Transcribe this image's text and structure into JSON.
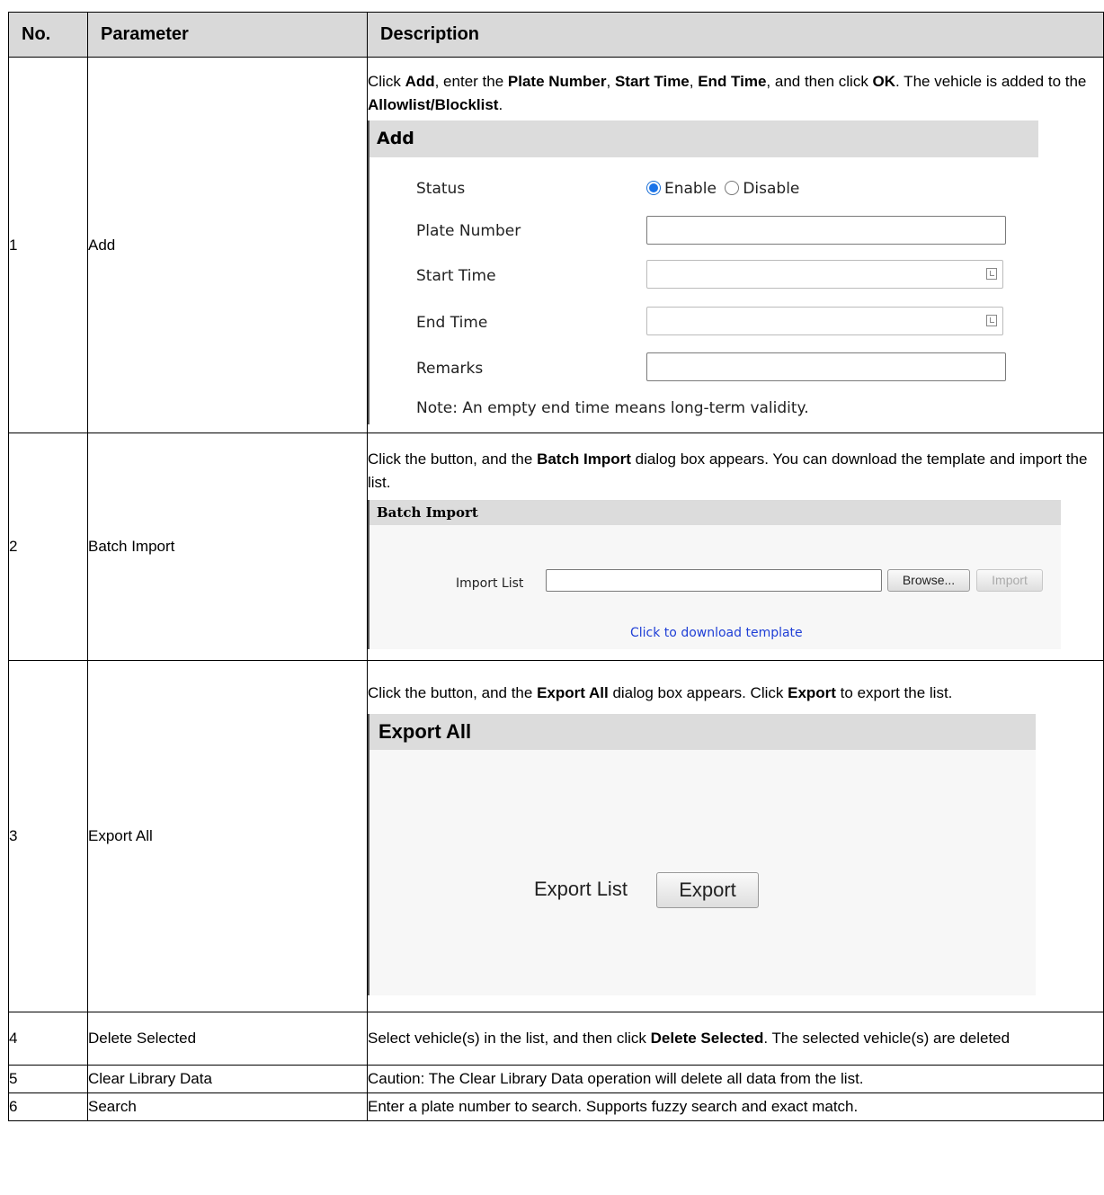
{
  "headers": {
    "no": "No.",
    "parameter": "Parameter",
    "description": "Description"
  },
  "rows": [
    {
      "no": "1",
      "parameter": "Add",
      "desc": {
        "t1": "Click ",
        "b1": "Add",
        "t2": ", enter the ",
        "b2": "Plate Number",
        "t3": ", ",
        "b3": "Start Time",
        "t4": ", ",
        "b4": "End Time",
        "t5": ", and then click ",
        "b5": "OK",
        "t6": ". The vehicle is added to the ",
        "b6": "Allowlist/Blocklist",
        "t7": "."
      }
    },
    {
      "no": "2",
      "parameter": "Batch Import",
      "desc": {
        "t1": "Click the button, and the ",
        "b1": "Batch Import",
        "t2": " dialog box appears. You can download the template and import the list."
      }
    },
    {
      "no": "3",
      "parameter": "Export All",
      "desc": {
        "t1": "Click the button, and the ",
        "b1": "Export All",
        "t2": " dialog box appears. Click ",
        "b2": "Export",
        "t3": " to export the list."
      }
    },
    {
      "no": "4",
      "parameter": "Delete Selected",
      "desc": {
        "t1": "Select vehicle(s) in the list, and then click ",
        "b1": "Delete Selected",
        "t2": ". The selected vehicle(s) are deleted"
      }
    },
    {
      "no": "5",
      "parameter": "Clear Library Data",
      "desc": {
        "t1": "Caution: The Clear Library Data operation will delete all data from the list."
      }
    },
    {
      "no": "6",
      "parameter": "Search",
      "desc": {
        "t1": "Enter a plate number to search. Supports fuzzy search and exact match."
      }
    }
  ],
  "add_dialog": {
    "title": "Add",
    "status_label": "Status",
    "enable_label": "Enable",
    "disable_label": "Disable",
    "status_value": "Enable",
    "plate_label": "Plate Number",
    "plate_value": "",
    "start_label": "Start Time",
    "start_value": "",
    "end_label": "End Time",
    "end_value": "",
    "remarks_label": "Remarks",
    "remarks_value": "",
    "note_prefix": "Note:",
    "note_text": " An empty end time means long-term validity."
  },
  "import_dialog": {
    "title": "Batch Import",
    "list_label": "Import List",
    "file_value": "",
    "browse_label": "Browse...",
    "import_label": "Import",
    "template_link": "Click to download template"
  },
  "export_dialog": {
    "title": "Export All",
    "list_label": "Export List",
    "export_label": "Export"
  },
  "colors": {
    "header_bg": "#d9d9d9",
    "dialog_title_bg": "#dcdcdc",
    "dialog_body_bg": "#f7f7f7",
    "link": "#1f3fd6",
    "radio_on": "#1a73e8"
  }
}
